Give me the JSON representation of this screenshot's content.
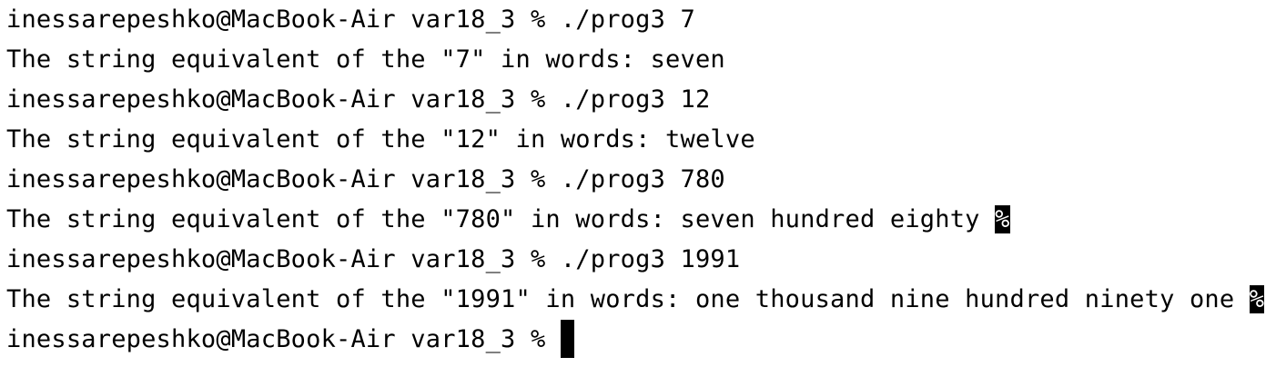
{
  "terminal": {
    "lines": [
      {
        "text": "inessarepeshko@MacBook-Air var18_3 % ./prog3 7",
        "type": "command"
      },
      {
        "text": "The string equivalent of the \"7\" in words: seven",
        "type": "output"
      },
      {
        "text": "inessarepeshko@MacBook-Air var18_3 % ./prog3 12",
        "type": "command"
      },
      {
        "text": "The string equivalent of the \"12\" in words: twelve",
        "type": "output"
      },
      {
        "text": "inessarepeshko@MacBook-Air var18_3 % ./prog3 780",
        "type": "command"
      },
      {
        "text": "The string equivalent of the \"780\" in words: seven hundred eighty ",
        "type": "output",
        "marker": "%"
      },
      {
        "text": "inessarepeshko@MacBook-Air var18_3 % ./prog3 1991",
        "type": "command"
      },
      {
        "text": "The string equivalent of the \"1991\" in words: one thousand nine hundred ninety one ",
        "type": "output",
        "marker": "%"
      },
      {
        "text": "inessarepeshko@MacBook-Air var18_3 % ",
        "type": "prompt"
      }
    ]
  }
}
